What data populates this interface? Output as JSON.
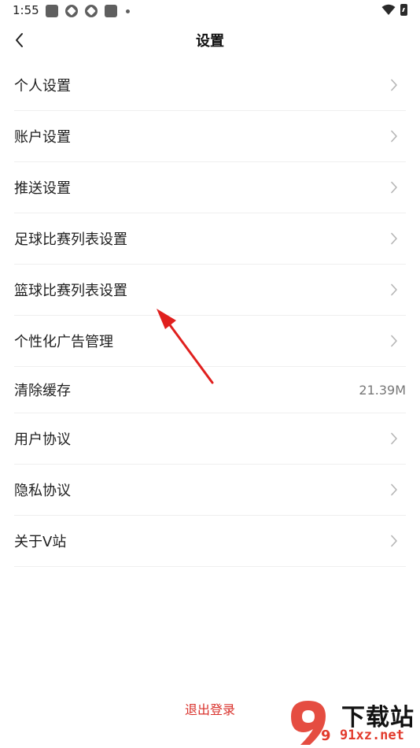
{
  "status_bar": {
    "time": "1:55"
  },
  "header": {
    "title": "设置"
  },
  "settings": [
    {
      "label": "个人设置",
      "value": ""
    },
    {
      "label": "账户设置",
      "value": ""
    },
    {
      "label": "推送设置",
      "value": ""
    },
    {
      "label": "足球比赛列表设置",
      "value": ""
    },
    {
      "label": "篮球比赛列表设置",
      "value": ""
    },
    {
      "label": "个性化广告管理",
      "value": ""
    },
    {
      "label": "清除缓存",
      "value": "21.39M"
    },
    {
      "label": "用户协议",
      "value": ""
    },
    {
      "label": "隐私协议",
      "value": ""
    },
    {
      "label": "关于V站",
      "value": ""
    }
  ],
  "logout_label": "退出登录",
  "watermark": {
    "top": "下载站",
    "bottom": "91xz.net",
    "logo_glyph": "9"
  },
  "colors": {
    "accent": "#d9312b",
    "annotation": "#e0201e",
    "divider": "#efefef"
  }
}
